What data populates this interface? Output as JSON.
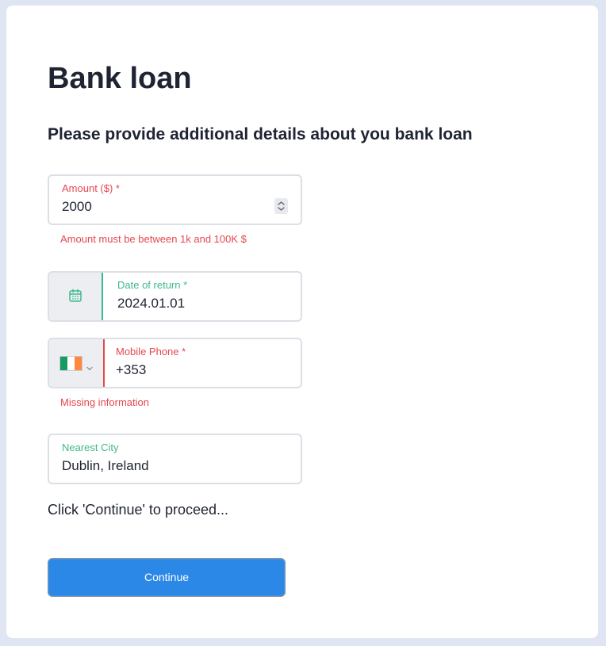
{
  "page": {
    "title": "Bank loan",
    "subtitle": "Please provide additional details about you bank loan",
    "hint": "Click 'Continue' to proceed..."
  },
  "colors": {
    "error": "#e5484d",
    "valid": "#3dba8c",
    "primary": "#2b88e6"
  },
  "fields": {
    "amount": {
      "label": "Amount ($) *",
      "value": "2000",
      "error": "Amount must be between 1k and 100K $",
      "state": "error",
      "icon": "stepper-icon"
    },
    "date_of_return": {
      "label": "Date of return *",
      "value": "2024.01.01",
      "state": "valid",
      "icon": "calendar-icon"
    },
    "mobile_phone": {
      "label": "Mobile Phone *",
      "value": "+353",
      "error": "Missing information",
      "state": "error",
      "country_flag": "ireland-flag-icon",
      "flag_colors": [
        "#169b62",
        "#ffffff",
        "#ff883e"
      ]
    },
    "nearest_city": {
      "label": "Nearest City",
      "value": "Dublin, Ireland",
      "state": "valid"
    }
  },
  "actions": {
    "continue_label": "Continue"
  }
}
